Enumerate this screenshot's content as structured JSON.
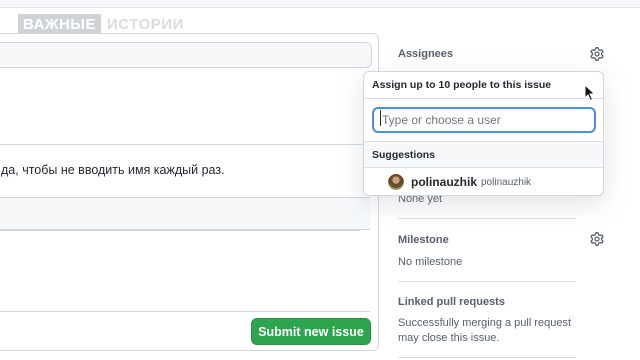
{
  "watermark": {
    "box_text": "ВАЖНЫЕ",
    "trailing_text": "ИСТОРИИ"
  },
  "editor": {
    "body_text": "да, чтобы не вводить имя каждый раз.",
    "submit_label": "Submit new issue"
  },
  "sidebar": {
    "assignees": {
      "heading": "Assignees",
      "value": "None yet"
    },
    "milestone": {
      "heading": "Milestone",
      "value": "No milestone"
    },
    "linked_prs": {
      "heading": "Linked pull requests",
      "description": "Successfully merging a pull request may close this issue."
    }
  },
  "assign_dropdown": {
    "header": "Assign up to 10 people to this issue",
    "filter_placeholder": "Type or choose a user",
    "suggestions_heading": "Suggestions",
    "suggestions": [
      {
        "login": "polinauzhik",
        "name": "polinauzhik"
      }
    ]
  },
  "icons": {
    "gear": "gear-icon",
    "pointer": "mouse-pointer-icon"
  },
  "colors": {
    "accent_green": "#2da44e",
    "focus_blue": "#4c8fe0"
  }
}
